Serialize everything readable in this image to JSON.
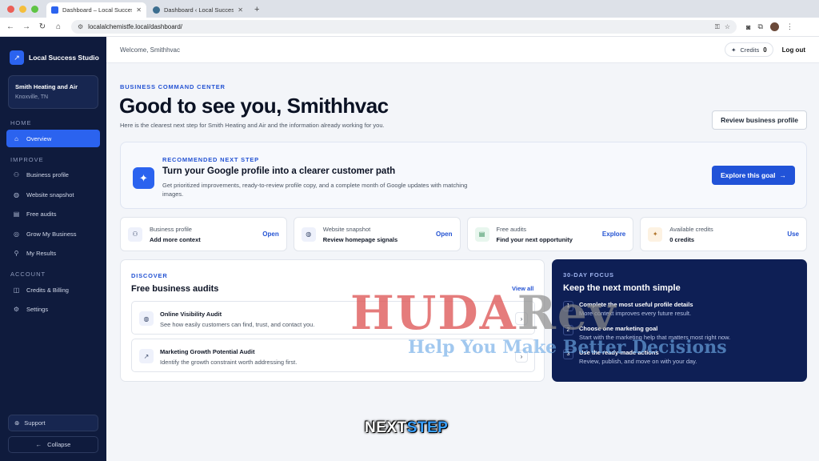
{
  "browser": {
    "tabs": [
      {
        "label": "Dashboard – Local Success S",
        "active": true
      },
      {
        "label": "Dashboard ‹ Local Success St",
        "active": false
      }
    ],
    "url": "localalchemistfe.local/dashboard/"
  },
  "sidebar": {
    "brand": "Local Success Studio",
    "business_name": "Smith Heating and Air",
    "business_location": "Knoxville, TN",
    "section_home": "HOME",
    "section_improve": "IMPROVE",
    "section_account": "ACCOUNT",
    "items": {
      "overview": "Overview",
      "business_profile": "Business profile",
      "website_snapshot": "Website snapshot",
      "free_audits": "Free audits",
      "grow": "Grow My Business",
      "results": "My Results",
      "credits_billing": "Credits & Billing",
      "settings": "Settings"
    },
    "support": "Support",
    "collapse": "Collapse"
  },
  "header": {
    "welcome": "Welcome, Smithhvac",
    "credits_label": "Credits",
    "credits_value": "0",
    "logout": "Log out"
  },
  "main": {
    "eyebrow": "BUSINESS COMMAND CENTER",
    "headline": "Good to see you, Smithhvac",
    "subline": "Here is the clearest next step for Smith Heating and Air and the information already working for you.",
    "review_button": "Review business profile",
    "reco": {
      "eyebrow": "RECOMMENDED NEXT STEP",
      "title": "Turn your Google profile into a clearer customer path",
      "desc": "Get prioritized improvements, ready-to-review profile copy, and a complete month of Google updates with matching images.",
      "button": "Explore this goal"
    },
    "stats": [
      {
        "label": "Business profile",
        "value": "Add more context",
        "action": "Open"
      },
      {
        "label": "Website snapshot",
        "value": "Review homepage signals",
        "action": "Open"
      },
      {
        "label": "Free audits",
        "value": "Find your next opportunity",
        "action": "Explore"
      },
      {
        "label": "Available credits",
        "value": "0 credits",
        "action": "Use"
      }
    ],
    "discover": {
      "eyebrow": "DISCOVER",
      "title": "Free business audits",
      "view_all": "View all",
      "audits": [
        {
          "title": "Online Visibility Audit",
          "desc": "See how easily customers can find, trust, and contact you."
        },
        {
          "title": "Marketing Growth Potential Audit",
          "desc": "Identify the growth constraint worth addressing first."
        }
      ]
    },
    "focus": {
      "eyebrow": "30-DAY FOCUS",
      "title": "Keep the next month simple",
      "steps": [
        {
          "num": "1",
          "title": "Complete the most useful profile details",
          "desc": "More context improves every future result."
        },
        {
          "num": "2",
          "title": "Choose one marketing goal",
          "desc": "Start with the marketing help that matters most right now."
        },
        {
          "num": "3",
          "title": "Use the ready-made actions",
          "desc": "Review, publish, and move on with your day."
        }
      ]
    }
  },
  "overlay": {
    "watermark_a": "HUDA",
    "watermark_b": "Rev",
    "watermark_sub": "Help You Make Better Decisions",
    "nextstep_a": "NEXT",
    "nextstep_b": "STEP"
  }
}
